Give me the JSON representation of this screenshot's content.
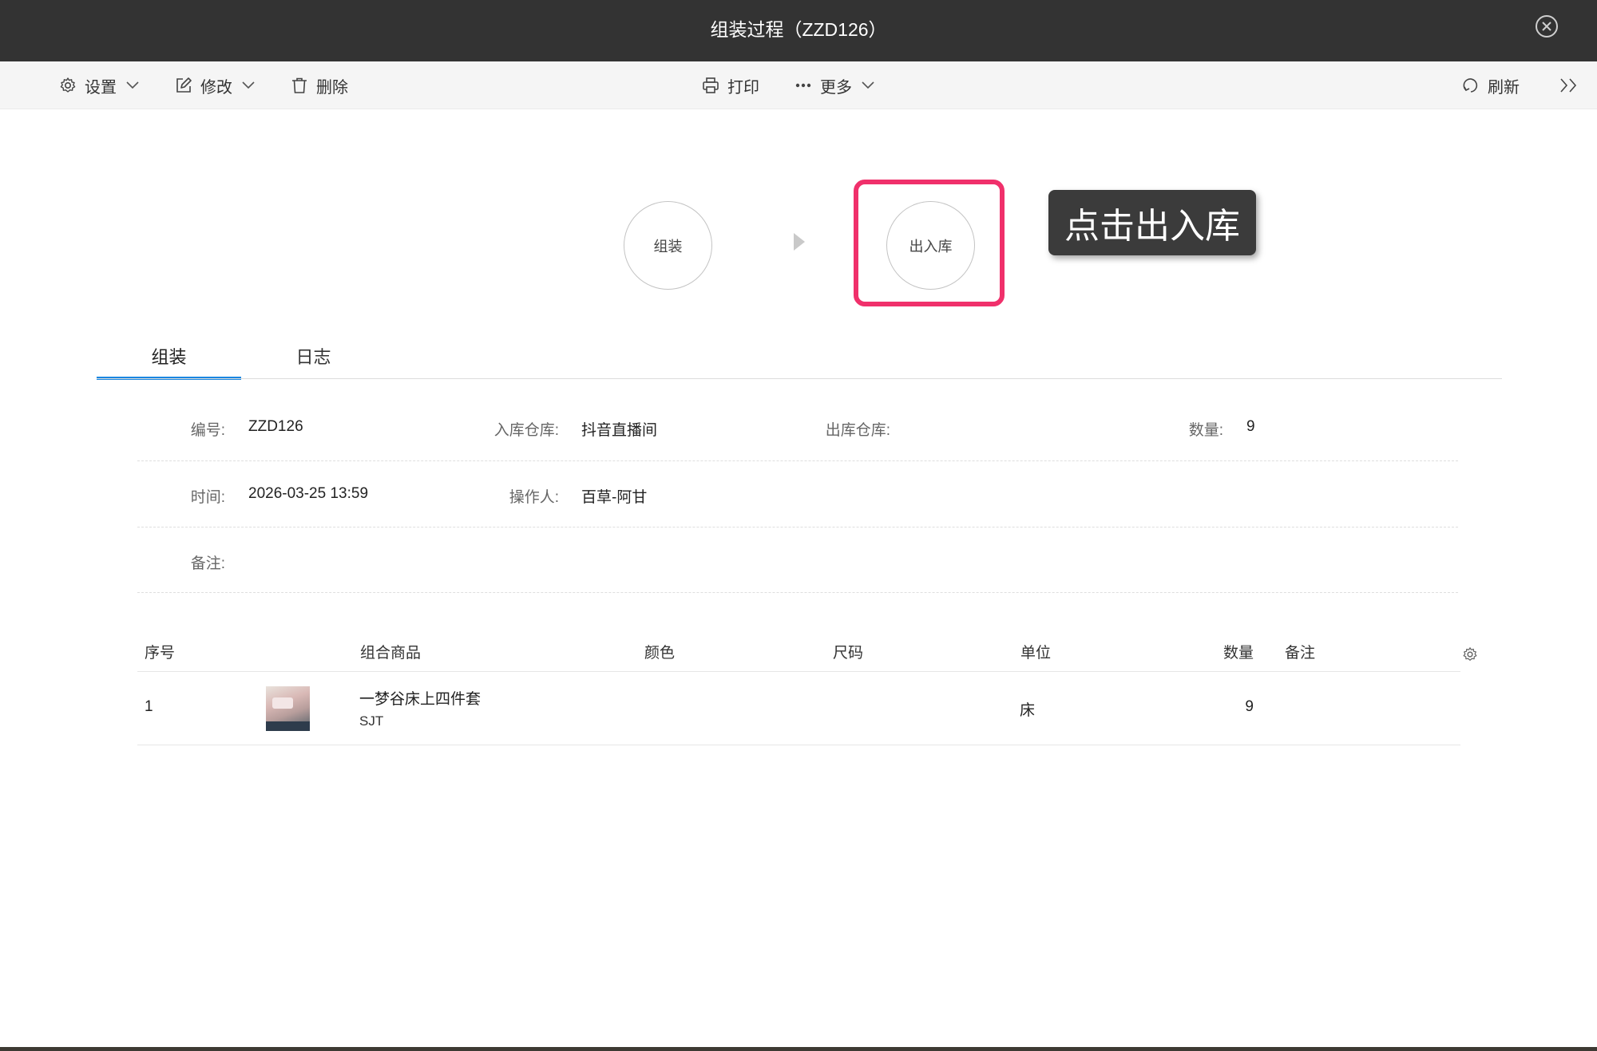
{
  "window": {
    "title": "组装过程（ZZD126）"
  },
  "toolbar": {
    "settings_label": "设置",
    "edit_label": "修改",
    "delete_label": "删除",
    "print_label": "打印",
    "more_label": "更多",
    "refresh_label": "刷新",
    "expand_label": ">>"
  },
  "flow": {
    "steps": [
      "组装",
      "出入库"
    ],
    "tooltip": "点击出入库",
    "highlight_color": "#f0306b"
  },
  "tabs": [
    {
      "label": "组装",
      "active": true
    },
    {
      "label": "日志",
      "active": false
    }
  ],
  "info": {
    "code_label": "编号:",
    "code_value": "ZZD126",
    "in_warehouse_label": "入库仓库:",
    "in_warehouse_value": "抖音直播间",
    "out_warehouse_label": "出库仓库:",
    "quantity_label": "数量:",
    "quantity_value": "9",
    "time_label": "时间:",
    "time_value": "2026-03-25 13:59",
    "operator_label": "操作人:",
    "operator_value": "百草-阿甘",
    "remark_label": "备注:"
  },
  "table": {
    "columns": [
      "序号",
      "组合商品",
      "颜色",
      "尺码",
      "单位",
      "数量",
      "备注"
    ],
    "rows": [
      {
        "index": "1",
        "product_name": "一梦谷床上四件套",
        "product_code": "SJT",
        "color": "",
        "size": "",
        "unit": "床",
        "quantity": "9",
        "remark": ""
      }
    ]
  },
  "colors": {
    "titlebar": "#333333",
    "accent": "#1a86e0"
  },
  "icons": [
    "close-icon",
    "gear-icon",
    "edit-icon",
    "trash-icon",
    "printer-icon",
    "more-dots-icon",
    "refresh-icon",
    "chevron-down-icon",
    "double-chevron-right-icon"
  ]
}
